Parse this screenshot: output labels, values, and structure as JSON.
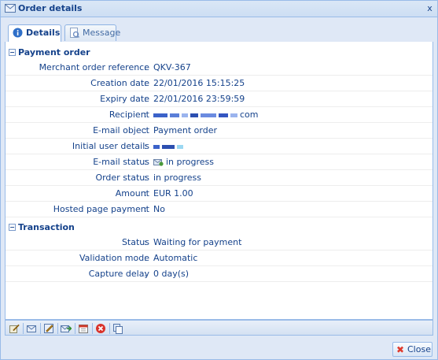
{
  "window": {
    "title": "Order details",
    "close_glyph": "x"
  },
  "tabs": [
    {
      "label": "Details",
      "icon": "info-icon",
      "active": true
    },
    {
      "label": "Message",
      "icon": "message-icon",
      "active": false
    }
  ],
  "payment_order": {
    "header": "Payment order",
    "rows": [
      {
        "label": "Merchant order reference",
        "value": "QKV-367"
      },
      {
        "label": "Creation date",
        "value": "22/01/2016 15:15:25"
      },
      {
        "label": "Expiry date",
        "value": "22/01/2016 23:59:59"
      },
      {
        "label": "Recipient",
        "value": "com"
      },
      {
        "label": "E-mail object",
        "value": "Payment order"
      },
      {
        "label": "Initial user details",
        "value": ""
      },
      {
        "label": "E-mail status",
        "value": "in progress"
      },
      {
        "label": "Order status",
        "value": "in progress"
      },
      {
        "label": "Amount",
        "value": "EUR 1.00"
      },
      {
        "label": "Hosted page payment",
        "value": "No"
      }
    ]
  },
  "transaction": {
    "header": "Transaction",
    "rows": [
      {
        "label": "Status",
        "value": "Waiting for payment"
      },
      {
        "label": "Validation mode",
        "value": "Automatic"
      },
      {
        "label": "Capture delay",
        "value": "0 day(s)"
      }
    ]
  },
  "footer": {
    "close_label": "Close"
  },
  "colors": {
    "accent": "#15428b",
    "border": "#99bbe8",
    "close_icon": "#e03a2c"
  }
}
